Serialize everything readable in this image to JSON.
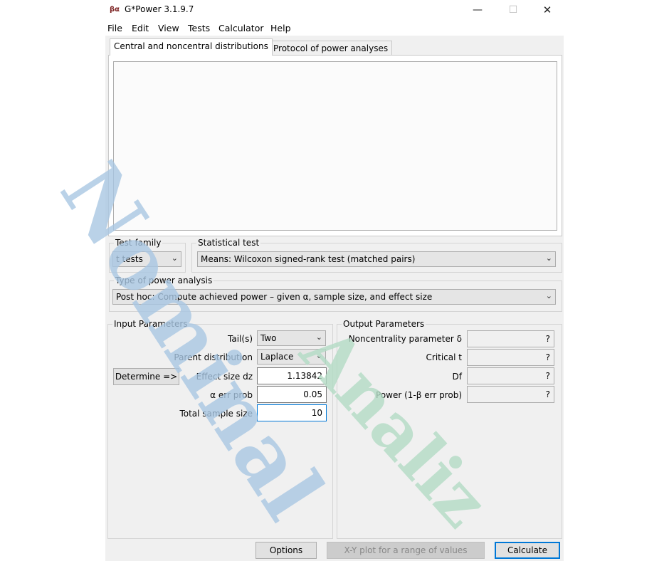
{
  "window": {
    "title": "G*Power 3.1.9.7",
    "app_icon_text": "βα",
    "controls": {
      "minimize": "—",
      "maximize": "☐",
      "close": "✕"
    }
  },
  "menu": [
    "File",
    "Edit",
    "View",
    "Tests",
    "Calculator",
    "Help"
  ],
  "tabs": [
    {
      "label": "Central and noncentral distributions",
      "active": true
    },
    {
      "label": "Protocol of power analyses",
      "active": false
    }
  ],
  "test_family": {
    "label": "Test family",
    "value": "t tests"
  },
  "statistical_test": {
    "label": "Statistical test",
    "value": "Means: Wilcoxon signed-rank test (matched pairs)"
  },
  "power_analysis": {
    "label": "Type of power analysis",
    "value": "Post hoc: Compute achieved power – given α, sample size, and effect size"
  },
  "input_parameters": {
    "title": "Input Parameters",
    "tails": {
      "label": "Tail(s)",
      "value": "Two"
    },
    "parent_distribution": {
      "label": "Parent distribution",
      "value": "Laplace"
    },
    "determine_button": "Determine =>",
    "effect_size": {
      "label": "Effect size dz",
      "value": "1.13842"
    },
    "alpha": {
      "label": "α err prob",
      "value": "0.05"
    },
    "sample_size": {
      "label": "Total sample size",
      "value": "10"
    }
  },
  "output_parameters": {
    "title": "Output Parameters",
    "noncentrality": {
      "label": "Noncentrality parameter δ",
      "value": "?"
    },
    "critical_t": {
      "label": "Critical t",
      "value": "?"
    },
    "df": {
      "label": "Df",
      "value": "?"
    },
    "power": {
      "label": "Power (1-β err prob)",
      "value": "?"
    }
  },
  "buttons": {
    "options": "Options",
    "xy_plot": "X-Y plot for a range of values",
    "calculate": "Calculate"
  },
  "watermark": {
    "word1": "Nominal",
    "word2": "Analiz",
    "color1": "#a9c7e3",
    "color2": "#b3dcc5"
  }
}
